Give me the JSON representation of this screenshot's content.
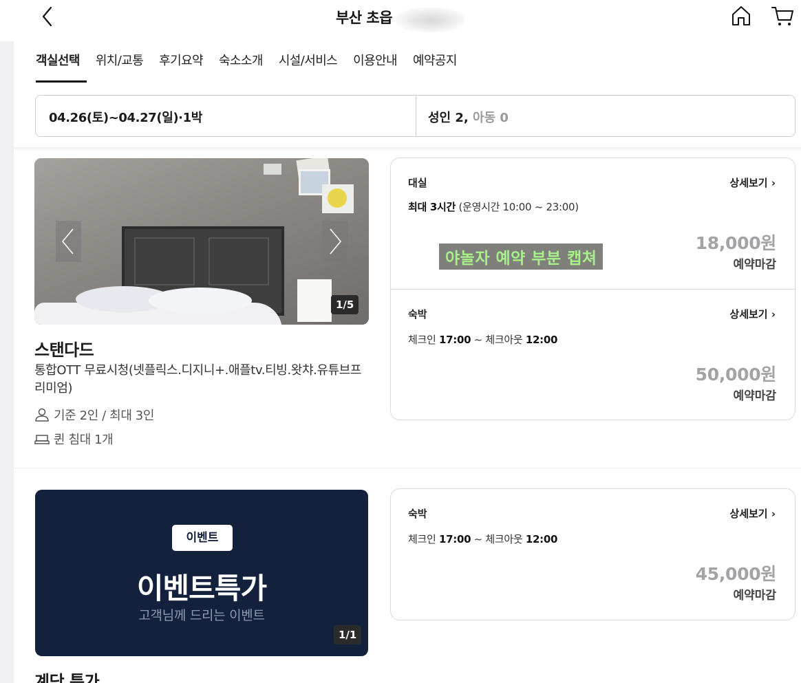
{
  "header": {
    "title": "부산 초읍"
  },
  "tabs": [
    {
      "label": "객실선택",
      "active": true
    },
    {
      "label": "위치/교통"
    },
    {
      "label": "후기요약"
    },
    {
      "label": "숙소소개"
    },
    {
      "label": "시설/서비스"
    },
    {
      "label": "이용안내"
    },
    {
      "label": "예약공지"
    }
  ],
  "selector": {
    "date": "04.26(토)~04.27(일)·1박",
    "guests_adults": "성인 2,",
    "guests_children": "아동 0"
  },
  "rooms": [
    {
      "image_counter": "1/5",
      "name": "스탠다드",
      "description": "통합OTT 무료시청(넷플릭스.디지니+.애플tv.티빙.왓챠.유튜브프리미엄)",
      "capacity": "기준 2인 / 최대 3인",
      "bed": "퀸 침대 1개",
      "offers": [
        {
          "type": "대실",
          "detail_bold": "최대 3시간",
          "detail_rest": " (운영시간 10:00 ~ 23:00)",
          "link": "상세보기 ›",
          "price": "18,000원",
          "status": "예약마감"
        },
        {
          "type": "숙박",
          "checkin_label": "체크인 ",
          "checkin_time": "17:00",
          "checkout_label": " ~ 체크아웃 ",
          "checkout_time": "12:00",
          "link": "상세보기 ›",
          "price": "50,000원",
          "status": "예약마감"
        }
      ]
    },
    {
      "banner_badge": "이벤트",
      "banner_title": "이벤트특가",
      "banner_subtitle": "고객님께 드리는 이벤트",
      "image_counter": "1/1",
      "name": "계단 특가",
      "offers": [
        {
          "type": "숙박",
          "checkin_label": "체크인 ",
          "checkin_time": "17:00",
          "checkout_label": " ~ 체크아웃 ",
          "checkout_time": "12:00",
          "link": "상세보기 ›",
          "price": "45,000원",
          "status": "예약마감"
        }
      ]
    }
  ],
  "overlay_caption": "야놀자 예약 부분 캡쳐",
  "icons": {
    "back": "chevron-left-icon",
    "home": "home-icon",
    "cart": "cart-icon",
    "person": "person-icon",
    "bed": "bed-icon"
  },
  "colors": {
    "price_gray": "#a3a3a7",
    "event_banner": "#13213d",
    "overlay_text": "#a8f08a"
  }
}
